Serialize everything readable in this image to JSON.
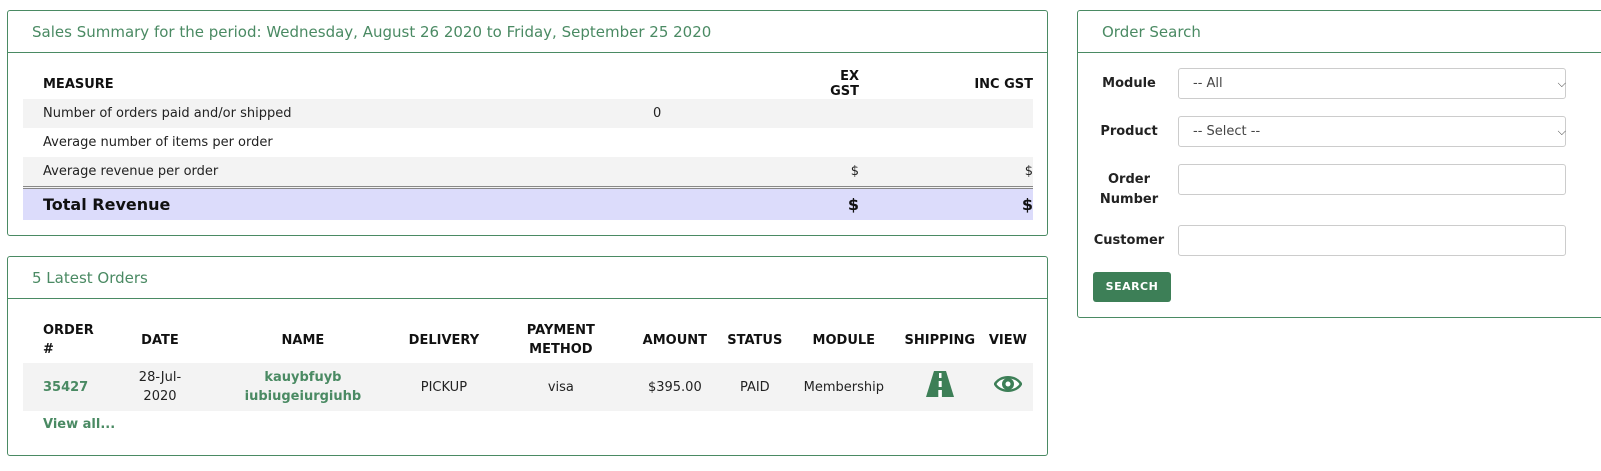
{
  "sales_summary": {
    "title": "Sales Summary for the period: Wednesday, August 26 2020 to Friday, September 25 2020",
    "headers": {
      "measure": "MEASURE",
      "ex_gst": "EX GST",
      "inc_gst": "INC GST"
    },
    "rows": [
      {
        "label": "Number of orders paid and/or shipped",
        "value": "0",
        "ex": "",
        "inc": ""
      },
      {
        "label": "Average number of items per order",
        "value": "",
        "ex": "",
        "inc": ""
      },
      {
        "label": "Average revenue per order",
        "value": "",
        "ex": "$",
        "inc": "$"
      }
    ],
    "total": {
      "label": "Total Revenue",
      "ex": "$",
      "inc": "$"
    }
  },
  "latest_orders": {
    "title": "5 Latest Orders",
    "headers": {
      "order_line1": "ORDER",
      "order_line2": "#",
      "date": "DATE",
      "name": "NAME",
      "delivery": "DELIVERY",
      "payment_line1": "PAYMENT",
      "payment_line2": "METHOD",
      "amount": "AMOUNT",
      "status": "STATUS",
      "module": "MODULE",
      "shipping": "SHIPPING",
      "view": "VIEW"
    },
    "rows": [
      {
        "order_no": "35427",
        "date_line1": "28-Jul-",
        "date_line2": "2020",
        "name_line1": "kauybfuyb",
        "name_line2": "iubiugeiurgiuhb",
        "delivery": "PICKUP",
        "payment": "visa",
        "amount": "$395.00",
        "status": "PAID",
        "module": "Membership",
        "shipping_icon": "road-icon",
        "view_icon": "eye-icon"
      }
    ],
    "view_all": "View all..."
  },
  "order_search": {
    "title": "Order Search",
    "module_label": "Module",
    "module_value": "-- All",
    "product_label": "Product",
    "product_value": "-- Select --",
    "order_number_label_line1": "Order",
    "order_number_label_line2": "Number",
    "order_number_value": "",
    "customer_label": "Customer",
    "customer_value": "",
    "search_button": "SEARCH"
  },
  "colors": {
    "accent": "#4a8a63",
    "total_bg": "#dcdcfb",
    "button": "#3d7f57"
  }
}
